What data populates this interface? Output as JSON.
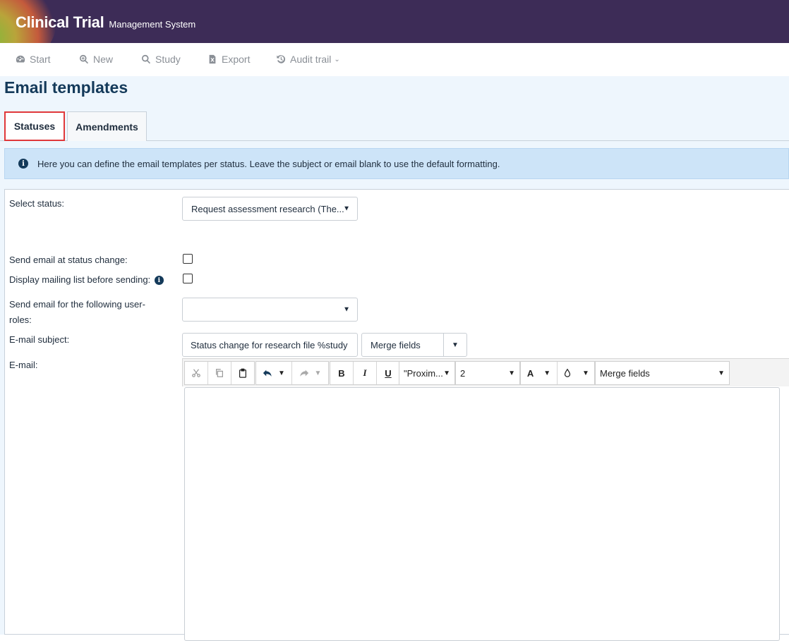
{
  "header": {
    "brand_main": "Clinical Trial",
    "brand_sub": "Management System"
  },
  "nav": {
    "items": [
      {
        "label": "Start",
        "icon": "dashboard-icon"
      },
      {
        "label": "New",
        "icon": "zoom-plus-icon"
      },
      {
        "label": "Study",
        "icon": "search-icon"
      },
      {
        "label": "Export",
        "icon": "excel-file-icon"
      },
      {
        "label": "Audit trail",
        "icon": "history-icon"
      }
    ]
  },
  "page": {
    "title": "Email templates",
    "tabs": [
      {
        "label": "Statuses",
        "active": true
      },
      {
        "label": "Amendments",
        "active": false
      }
    ],
    "info_text": "Here you can define the email templates per status. Leave the subject or email blank to use the default formatting."
  },
  "form": {
    "select_status_label": "Select status:",
    "select_status_value": "Request assessment research (The...",
    "send_email_label": "Send email at status change:",
    "display_mailing_label": "Display mailing list before sending:",
    "user_roles_label": "Send email for the following user-roles:",
    "user_roles_value": "",
    "subject_label": "E-mail subject:",
    "subject_value": "Status change for research file %study",
    "merge_fields_label": "Merge fields",
    "email_label": "E-mail:"
  },
  "editor": {
    "font_family": "\"Proxim...",
    "font_size": "2",
    "bold": "B",
    "italic": "I",
    "underline": "U",
    "font_color": "A",
    "merge_fields": "Merge fields"
  },
  "colors": {
    "header_bg": "#3d2c57",
    "page_bg": "#eef6fd",
    "info_bg": "#cde4f8",
    "title": "#143a5a",
    "active_tab_border": "#e0383a"
  }
}
